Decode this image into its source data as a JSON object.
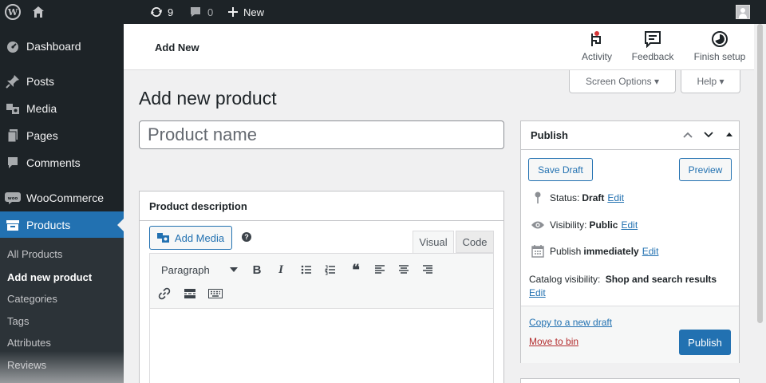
{
  "adminbar": {
    "updates_count": "9",
    "comments_count": "0",
    "new_label": "New"
  },
  "sidebar": {
    "items": [
      {
        "label": "Dashboard",
        "icon": "dashboard-icon"
      },
      {
        "label": "Posts",
        "icon": "pin-icon"
      },
      {
        "label": "Media",
        "icon": "media-icon"
      },
      {
        "label": "Pages",
        "icon": "pages-icon"
      },
      {
        "label": "Comments",
        "icon": "comment-icon"
      },
      {
        "label": "WooCommerce",
        "icon": "woo-icon"
      },
      {
        "label": "Products",
        "icon": "archive-icon"
      }
    ],
    "submenu": [
      "All Products",
      "Add new product",
      "Categories",
      "Tags",
      "Attributes",
      "Reviews"
    ]
  },
  "header": {
    "title": "Add New",
    "activity_label": "Activity",
    "feedback_label": "Feedback",
    "finish_setup_label": "Finish setup"
  },
  "screen_options_label": "Screen Options ▾",
  "help_label": "Help ▾",
  "page_title": "Add new product",
  "product_name_placeholder": "Product name",
  "description": {
    "title": "Product description",
    "add_media_label": "Add Media",
    "tab_visual": "Visual",
    "tab_code": "Code",
    "format_select": "Paragraph"
  },
  "publish": {
    "title": "Publish",
    "save_draft": "Save Draft",
    "preview": "Preview",
    "status_label": "Status:",
    "status_value": "Draft",
    "visibility_label": "Visibility:",
    "visibility_value": "Public",
    "publish_label": "Publish",
    "publish_value": "immediately",
    "edit": "Edit",
    "catalog_label": "Catalog visibility:",
    "catalog_value": "Shop and search results",
    "copy_draft": "Copy to a new draft",
    "move_bin": "Move to bin",
    "publish_button": "Publish"
  },
  "colors": {
    "admin_dark": "#1d2327",
    "accent": "#2271b1",
    "danger": "#b32d2e",
    "activity_badge": "#d63638"
  }
}
